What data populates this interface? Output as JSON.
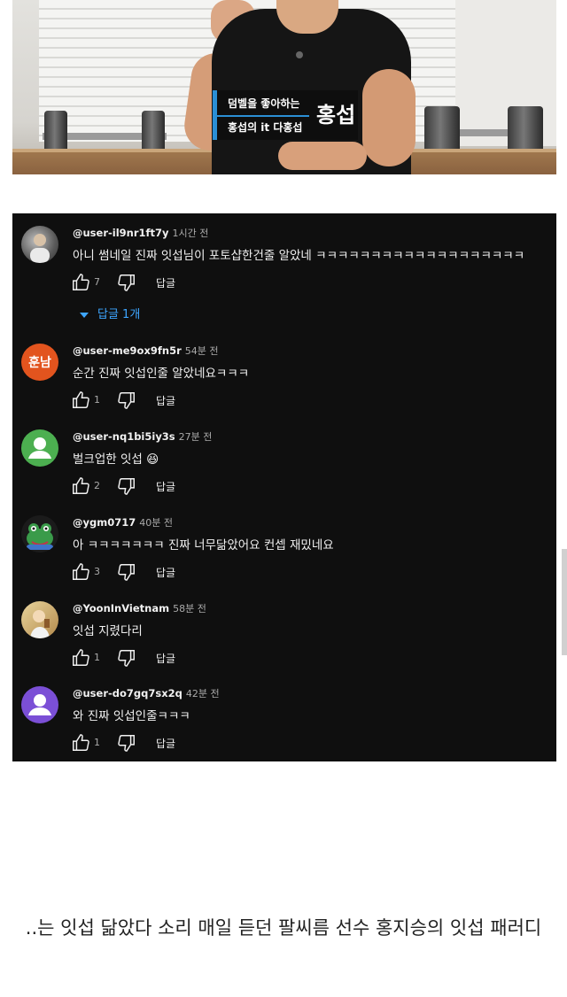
{
  "video": {
    "caption_line1": "덤벨을 좋아하는",
    "caption_line2": "홍섭의 it 다홍섭",
    "caption_name": "홍섭"
  },
  "comments": [
    {
      "handle": "@user-il9nr1ft7y",
      "time": "1시간 전",
      "text": "아니 썸네일 진짜 잇섭님이 포토샵한건줄 알았네 ㅋㅋㅋㅋㅋㅋㅋㅋㅋㅋㅋㅋㅋㅋㅋㅋㅋㅋㅋ",
      "likes": "7",
      "reply_label": "답글",
      "replies_toggle": "답글 1개",
      "avatar": "photo-avatar",
      "avatar_color": "#7a7a7a"
    },
    {
      "handle": "@user-me9ox9fn5r",
      "time": "54분 전",
      "text": "순간 진짜 잇섭인줄 알았네요ㅋㅋㅋ",
      "likes": "1",
      "reply_label": "답글",
      "avatar": "initials-avatar",
      "avatar_initials": "훈남",
      "avatar_color": "#e2541e"
    },
    {
      "handle": "@user-nq1bi5iy3s",
      "time": "27분 전",
      "text": "벌크업한 잇섭 😆",
      "likes": "2",
      "reply_label": "답글",
      "avatar": "default-user-avatar",
      "avatar_color": "#4caf50"
    },
    {
      "handle": "@ygm0717",
      "time": "40분 전",
      "text": "아 ㅋㅋㅋㅋㅋㅋㅋ 진짜 너무닮았어요 컨셉 재밌네요",
      "likes": "3",
      "reply_label": "답글",
      "avatar": "frog-avatar",
      "avatar_color": "#1b1b1b"
    },
    {
      "handle": "@YoonInVietnam",
      "time": "58분 전",
      "text": "잇섭 지렸다리",
      "likes": "1",
      "reply_label": "답글",
      "avatar": "photo-avatar",
      "avatar_color": "#c9b07a"
    },
    {
      "handle": "@user-do7gq7sx2q",
      "time": "42분 전",
      "text": "와 진짜 잇섭인줄ㅋㅋㅋ",
      "likes": "1",
      "reply_label": "답글",
      "avatar": "default-user-avatar",
      "avatar_color": "#7b4fd6"
    }
  ],
  "caption_text": "..는 잇섭 닮았다 소리 매일 듣던 팔씨름 선수 홍지승의 잇섭 패러디"
}
